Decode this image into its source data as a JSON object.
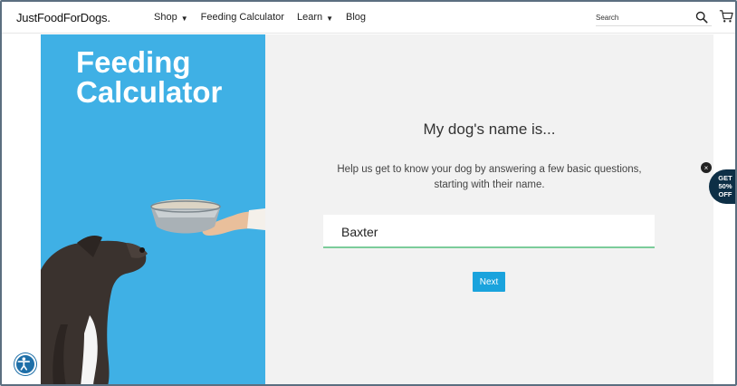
{
  "header": {
    "logo": "JustFoodForDogs.",
    "nav": [
      {
        "label": "Shop",
        "has_caret": true
      },
      {
        "label": "Feeding Calculator",
        "has_caret": false
      },
      {
        "label": "Learn",
        "has_caret": true
      },
      {
        "label": "Blog",
        "has_caret": false
      }
    ],
    "search": {
      "placeholder": "Search",
      "icon": "search-icon"
    },
    "cart": {
      "icon": "cart-icon"
    }
  },
  "hero": {
    "title_line1": "Feeding",
    "title_line2": "Calculator",
    "background": "#3fb0e5"
  },
  "form": {
    "question": "My dog's name is...",
    "helper": "Help us get to know your dog by answering a few basic questions, starting with their name.",
    "name_value": "Baxter",
    "next_label": "Next",
    "accent": "#1aa3dd",
    "field_underline": "#7ccc9a"
  },
  "promo": {
    "close": "×",
    "line1": "GET",
    "line2": "50%",
    "line3": "OFF",
    "color": "#0d2f46"
  },
  "accessibility": {
    "icon": "accessibility-icon"
  }
}
